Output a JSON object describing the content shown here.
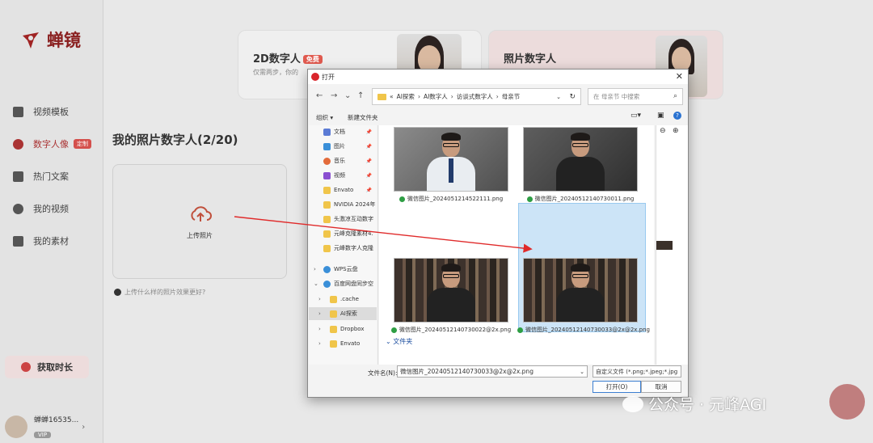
{
  "app": {
    "logo_text": "蝉镜",
    "nav": [
      {
        "label": "视频模板",
        "icon": "grid-icon"
      },
      {
        "label": "数字人像",
        "icon": "person-icon",
        "badge": "定制"
      },
      {
        "label": "热门文案",
        "icon": "text-icon"
      },
      {
        "label": "我的视频",
        "icon": "play-icon"
      },
      {
        "label": "我的素材",
        "icon": "folder-icon"
      }
    ],
    "get_time": "获取时长",
    "user": {
      "name": "蝉蝉16535...",
      "badge": "VIP"
    },
    "cards": [
      {
        "title": "2D数字人",
        "badge": "免费",
        "sub": "仅需两步，你的"
      },
      {
        "title": "照片数字人",
        "sub": ""
      }
    ],
    "section_title": "我的照片数字人(2/20)",
    "upload_label": "上传照片",
    "hint": "上传什么样的照片效果更好?"
  },
  "dialog": {
    "title": "打开",
    "breadcrumb": [
      "«",
      "AI探索",
      "›",
      "AI数字人",
      "›",
      "访谈式数字人",
      "›",
      "母亲节"
    ],
    "search_placeholder": "在 母亲节 中搜索",
    "organize": "组织 ▾",
    "new_folder": "新建文件夹",
    "tree": [
      {
        "label": "文档",
        "color": "#5b7bd5",
        "pin": true
      },
      {
        "label": "图片",
        "color": "#3a8fd8",
        "pin": true
      },
      {
        "label": "音乐",
        "color": "#e36b3a",
        "pin": true
      },
      {
        "label": "视频",
        "color": "#8a4fd1",
        "pin": true
      },
      {
        "label": "Envato",
        "color": "#f0c54a",
        "pin": true
      },
      {
        "label": "NVIDIA 2024年",
        "color": "#f0c54a"
      },
      {
        "label": "头激凉互动数字",
        "color": "#f0c54a"
      },
      {
        "label": "元峰克隆素材4.",
        "color": "#f0c54a"
      },
      {
        "label": "元峰数字人克隆",
        "color": "#f0c54a"
      },
      {
        "label": "WPS云盘",
        "color": "#3a8fd8",
        "exp": "›"
      },
      {
        "label": "百度网盘同步空",
        "color": "#3a8fd8",
        "exp": "⌄"
      },
      {
        "label": ".cache",
        "color": "#f0c54a",
        "exp": "›"
      },
      {
        "label": "AI探索",
        "color": "#f0c54a",
        "exp": "›",
        "selected": true
      },
      {
        "label": "Dropbox",
        "color": "#f0c54a",
        "exp": "›"
      },
      {
        "label": "Envato",
        "color": "#f0c54a",
        "exp": "›"
      }
    ],
    "files": [
      {
        "name": "微信图片_2024051214522111.png"
      },
      {
        "name": "微信图片_20240512140730011.png"
      },
      {
        "name": "微信图片_20240512140730022@2x.png"
      },
      {
        "name": "微信图片_20240512140730033@2x@2x.png"
      }
    ],
    "group_header": "文件夹",
    "filename_label": "文件名(N):",
    "filename_value": "微信图片_20240512140730033@2x@2x.png",
    "filter": "自定义文件 (*.png;*.jpeg;*.jpg",
    "open_btn": "打开(O)",
    "cancel_btn": "取消"
  },
  "watermark": "公众号 · 元峰AGI"
}
